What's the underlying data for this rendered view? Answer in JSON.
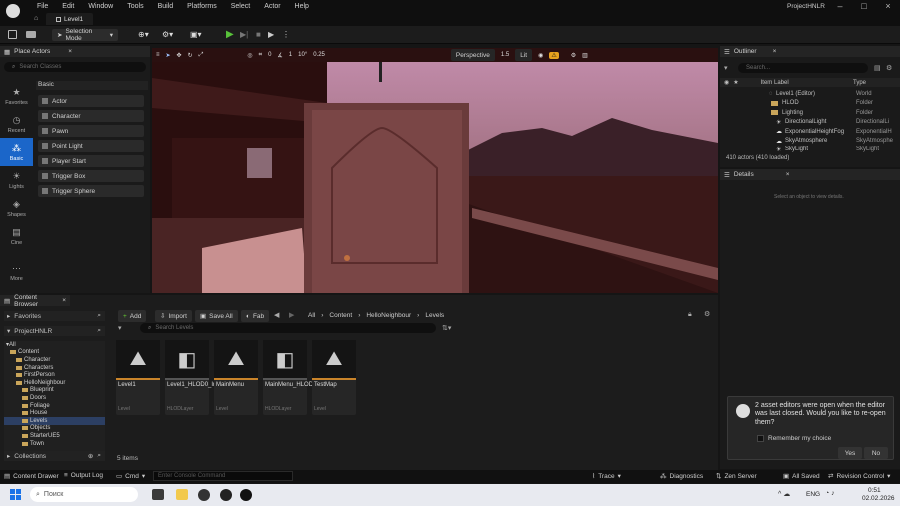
{
  "app": {
    "project": "ProjectHNLR",
    "level_tab": "Level1"
  },
  "menu": [
    "File",
    "Edit",
    "Window",
    "Tools",
    "Build",
    "Platforms",
    "Select",
    "Actor",
    "Help"
  ],
  "toolbar": {
    "mode": "Selection Mode"
  },
  "viewport": {
    "perspective": "Perspective",
    "lit": "Lit",
    "speed": "1.5",
    "grid_a": "0",
    "grid_b": "1",
    "angle": "10°",
    "scale": "0.25"
  },
  "place_actors": {
    "title": "Place Actors",
    "search_placeholder": "Search Classes",
    "section": "Basic",
    "categories": [
      "Favorites",
      "Recent",
      "Basic",
      "Lights",
      "Shapes",
      "Cine",
      "More"
    ],
    "items": [
      "Actor",
      "Character",
      "Pawn",
      "Point Light",
      "Player Start",
      "Trigger Box",
      "Trigger Sphere"
    ]
  },
  "outliner": {
    "title": "Outliner",
    "search_placeholder": "Search...",
    "col_label": "Item Label",
    "col_type": "Type",
    "rows": [
      {
        "label": "Level1 (Editor)",
        "type": "World"
      },
      {
        "label": "HLOD",
        "type": "Folder"
      },
      {
        "label": "Lighting",
        "type": "Folder"
      },
      {
        "label": "DirectionalLight",
        "type": "DirectionalLi"
      },
      {
        "label": "ExponentialHeightFog",
        "type": "ExponentialH"
      },
      {
        "label": "SkyAtmosphere",
        "type": "SkyAtmosphe"
      },
      {
        "label": "SkyLight",
        "type": "SkyLight"
      }
    ],
    "count": "410 actors (410 loaded)"
  },
  "details": {
    "title": "Details",
    "empty": "Select an object to view details."
  },
  "content_browser": {
    "title": "Content Browser",
    "favorites": "Favorites",
    "project": "ProjectHNLR",
    "collections": "Collections",
    "add": "Add",
    "import": "Import",
    "save_all": "Save All",
    "fab": "Fab",
    "breadcrumb": [
      "All",
      "Content",
      "HelloNeighbour",
      "Levels"
    ],
    "search_placeholder": "Search Levels",
    "items_count": "5 items",
    "tree": [
      "All",
      "Content",
      "Character",
      "Characters",
      "FirstPerson",
      "HelloNeighbour",
      "Blueprint",
      "Doors",
      "Foliage",
      "House",
      "Levels",
      "Objects",
      "StarterUE5",
      "Town"
    ],
    "assets": [
      {
        "name": "Level1",
        "type": "Level"
      },
      {
        "name": "Level1_HLOD0_Instancing",
        "type": "HLODLayer"
      },
      {
        "name": "MainMenu",
        "type": "Level"
      },
      {
        "name": "MainMenu_HLOD0_Instancing",
        "type": "HLODLayer"
      },
      {
        "name": "TestMap",
        "type": "Level"
      }
    ]
  },
  "notification": {
    "text": "2 asset editors were open when the editor was last closed. Would you like to re-open them?",
    "remember": "Remember my choice",
    "yes": "Yes",
    "no": "No"
  },
  "statusbar": {
    "drawer": "Content Drawer",
    "output": "Output Log",
    "cmd": "Cmd",
    "console_placeholder": "Enter Console Command",
    "trace": "Trace",
    "diagnostics": "Diagnostics",
    "zen": "Zen Server",
    "saved": "All Saved",
    "revision": "Revision Control"
  },
  "taskbar": {
    "search": "Поиск",
    "lang": "ENG",
    "time": "0:51",
    "date": "02.02.2026"
  }
}
